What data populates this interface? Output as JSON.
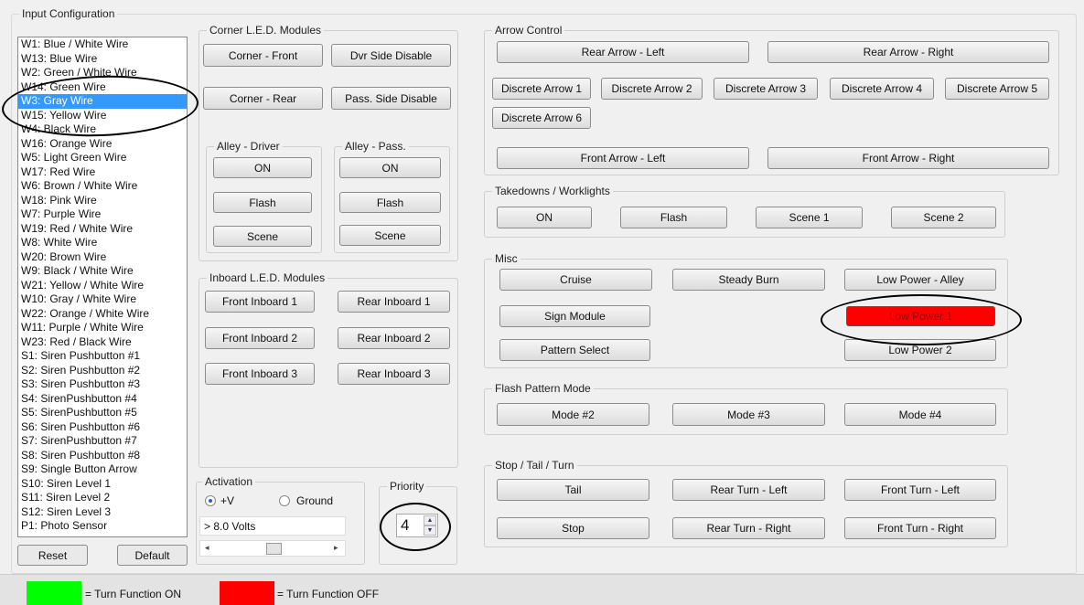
{
  "input_config": {
    "title": "Input Configuration",
    "wires": [
      "W1:  Blue / White Wire",
      "W13: Blue Wire",
      "W2:  Green / White Wire",
      "W14: Green Wire",
      "W3:  Gray Wire",
      "W15:  Yellow Wire",
      "W4:  Black Wire",
      "W16:  Orange Wire",
      "W5:  Light Green Wire",
      "W17: Red Wire",
      "W6:  Brown / White Wire",
      "W18: Pink Wire",
      "W7:  Purple Wire",
      "W19: Red / White Wire",
      "W8:  White Wire",
      "W20: Brown Wire",
      "W9:  Black / White Wire",
      "W21: Yellow / White Wire",
      "W10: Gray / White Wire",
      "W22: Orange / White Wire",
      "W11: Purple / White Wire",
      "W23: Red / Black Wire",
      "S1:  Siren Pushbutton #1",
      "S2:  Siren Pushbutton #2",
      "S3:  Siren Pushbutton #3",
      "S4:  SirenPushbutton #4",
      "S5:  SirenPushbutton #5",
      "S6:  Siren Pushbutton #6",
      "S7:  SirenPushbutton #7",
      "S8:  Siren Pushbutton #8",
      "S9:  Single Button Arrow",
      "S10: Siren Level 1",
      "S11: Siren Level 2",
      "S12: Siren Level 3",
      "P1:  Photo Sensor"
    ],
    "selected_index": 4,
    "reset_label": "Reset",
    "default_label": "Default"
  },
  "corner_led": {
    "title": "Corner L.E.D. Modules",
    "corner_front": "Corner - Front",
    "dvr_side_disable": "Dvr Side Disable",
    "corner_rear": "Corner - Rear",
    "pass_side_disable": "Pass. Side Disable",
    "alley_driver": {
      "title": "Alley - Driver",
      "on": "ON",
      "flash": "Flash",
      "scene": "Scene"
    },
    "alley_pass": {
      "title": "Alley - Pass.",
      "on": "ON",
      "flash": "Flash",
      "scene": "Scene"
    }
  },
  "inboard_led": {
    "title": "Inboard L.E.D. Modules",
    "front_1": "Front Inboard 1",
    "rear_1": "Rear Inboard 1",
    "front_2": "Front Inboard 2",
    "rear_2": "Rear Inboard 2",
    "front_3": "Front Inboard 3",
    "rear_3": "Rear Inboard 3"
  },
  "activation": {
    "title": "Activation",
    "opt_v": "+V",
    "opt_ground": "Ground",
    "selected": "+V",
    "voltage": "> 8.0 Volts"
  },
  "priority": {
    "title": "Priority",
    "value": "4"
  },
  "arrow_control": {
    "title": "Arrow Control",
    "rear_left": "Rear Arrow - Left",
    "rear_right": "Rear Arrow - Right",
    "discrete": [
      "Discrete Arrow 1",
      "Discrete Arrow 2",
      "Discrete Arrow 3",
      "Discrete Arrow 4",
      "Discrete Arrow 5",
      "Discrete Arrow 6"
    ],
    "front_left": "Front Arrow - Left",
    "front_right": "Front Arrow - Right"
  },
  "takedowns": {
    "title": "Takedowns / Worklights",
    "on": "ON",
    "flash": "Flash",
    "scene1": "Scene 1",
    "scene2": "Scene 2"
  },
  "misc": {
    "title": "Misc",
    "cruise": "Cruise",
    "steady_burn": "Steady Burn",
    "low_power_alley": "Low Power - Alley",
    "sign_module": "Sign Module",
    "low_power_1": "Low Power 1",
    "pattern_select": "Pattern Select",
    "low_power_2": "Low Power 2"
  },
  "flash_pattern": {
    "title": "Flash Pattern Mode",
    "mode2": "Mode #2",
    "mode3": "Mode #3",
    "mode4": "Mode #4"
  },
  "stop_tail_turn": {
    "title": "Stop / Tail / Turn",
    "tail": "Tail",
    "rear_turn_left": "Rear Turn - Left",
    "front_turn_left": "Front Turn - Left",
    "stop": "Stop",
    "rear_turn_right": "Rear Turn - Right",
    "front_turn_right": "Front Turn - Right"
  },
  "legend": {
    "on_label": "= Turn Function ON",
    "off_label": "= Turn Function OFF",
    "on_color": "#00ff00",
    "off_color": "#ff0000"
  }
}
